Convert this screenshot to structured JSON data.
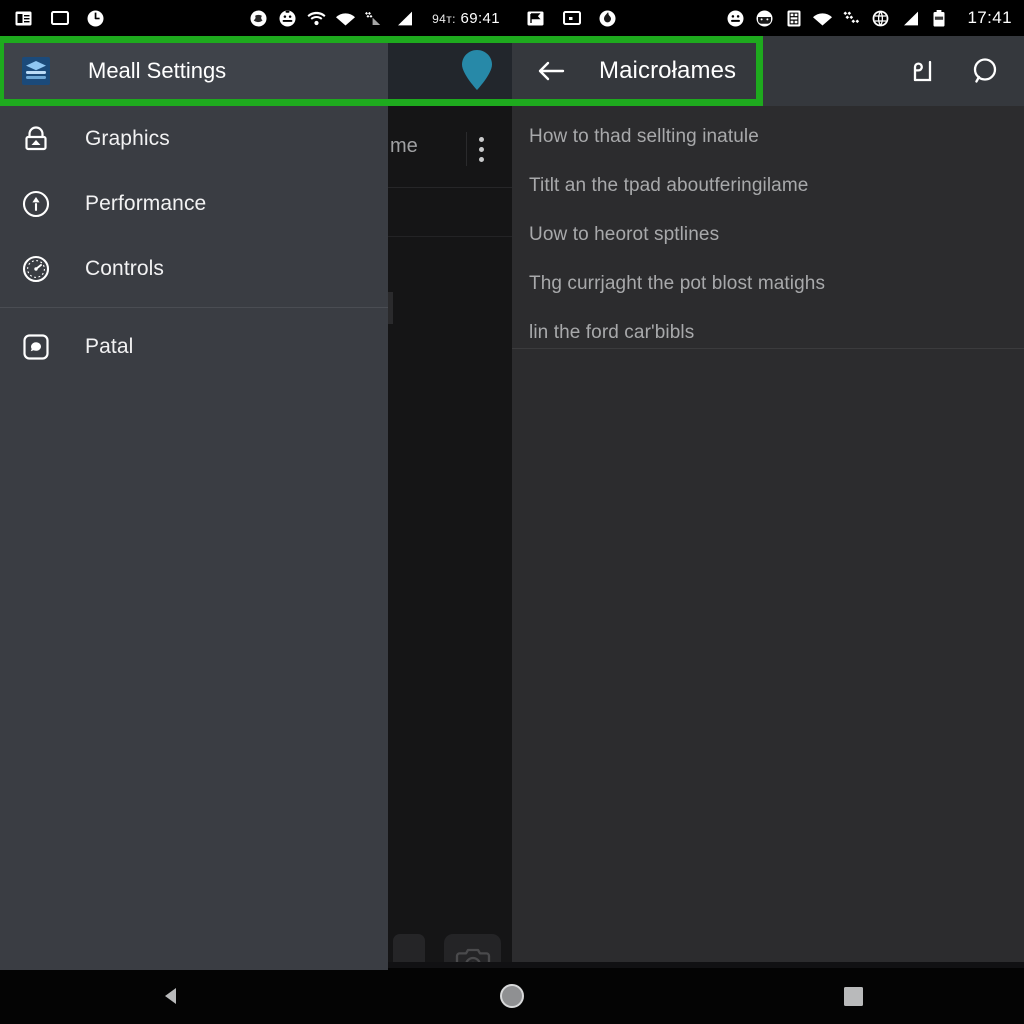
{
  "status_bar": {
    "left": {
      "icons": [
        "vcard-icon",
        "screenshot-icon",
        "clock-alert-icon"
      ],
      "right_icons": [
        "snapchat-icon",
        "face-icon",
        "wifi-icon",
        "wifi-2-icon",
        "sync-signal-icon",
        "signal-icon"
      ],
      "carrier": "94т:",
      "clock": "69:41"
    },
    "right": {
      "icons": [
        "flag-icon",
        "screenshot-icon",
        "fire-icon"
      ],
      "right_icons": [
        "face-icon",
        "mask-icon",
        "sim-icon",
        "wifi-icon",
        "sync-icon",
        "vpn-icon",
        "signal-icon",
        "battery-icon"
      ],
      "clock": "17:41"
    }
  },
  "drawer": {
    "header": {
      "icon": "layers-icon",
      "label": "Meall Settings"
    },
    "items": [
      {
        "icon": "lock-icon",
        "label": "Graphics"
      },
      {
        "icon": "performance-icon",
        "label": "Performance"
      },
      {
        "icon": "gauge-icon",
        "label": "Controls"
      },
      {
        "icon": "chat-icon",
        "label": "Patal"
      }
    ],
    "separator_after_index": 2
  },
  "app_bar": {
    "back_icon": "arrow-left-icon",
    "title": "Maicrołames",
    "actions": [
      {
        "icon": "bookmark-icon"
      },
      {
        "icon": "search-icon"
      }
    ]
  },
  "hint_list": {
    "items": [
      "How to thad sellting inatule",
      "Titlt an the tpad aboutferingilame",
      "Uow to heorot sptlines",
      "Thg currjaght the pot blost matighs",
      "lin the ford car'bibls"
    ]
  },
  "background_app": {
    "pin_icon": "map-pin-icon",
    "row_text_fragment": "me",
    "overflow_icon": "more-vertical-icon",
    "camera_icon": "camera-icon"
  },
  "nav_bar": {
    "buttons": [
      {
        "icon": "back-triangle-icon"
      },
      {
        "icon": "home-circle-icon"
      },
      {
        "icon": "recents-square-icon"
      }
    ]
  },
  "colors": {
    "highlight_green": "#1eaa1e",
    "drawer_bg": "#3a3d43",
    "drawer_header_bg": "#3f434a",
    "content_bg": "#2c2c2e",
    "app_bar_bg": "#35383d",
    "scrim_bg": "#151516",
    "accent_teal": "#2789a8",
    "accent_blue": "#2f7fd0"
  }
}
